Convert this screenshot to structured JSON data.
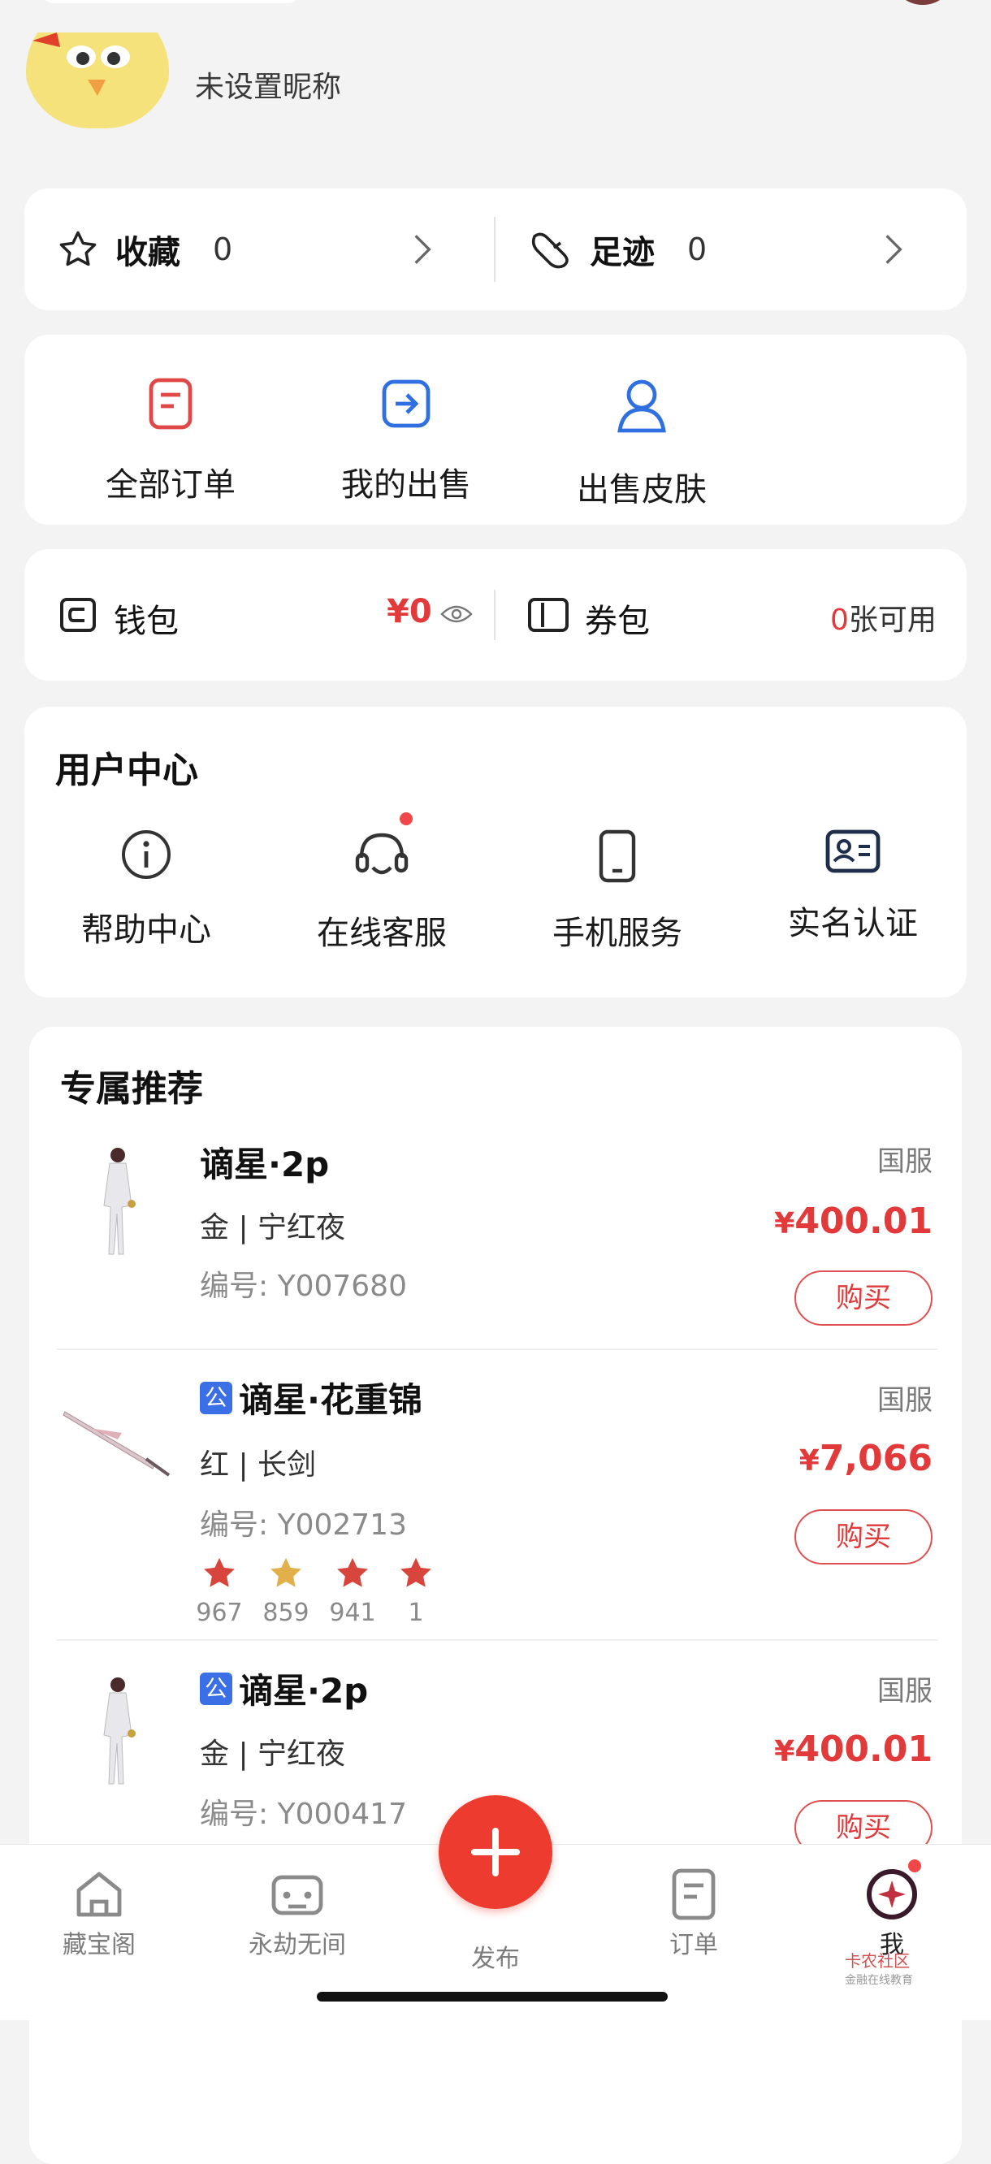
{
  "profile": {
    "nickname": "未设置昵称"
  },
  "favorites": {
    "collect": {
      "label": "收藏",
      "count": "0"
    },
    "footprint": {
      "label": "足迹",
      "count": "0"
    }
  },
  "orders": [
    {
      "label": "全部订单",
      "icon": "order-list-icon"
    },
    {
      "label": "我的出售",
      "icon": "sell-arrow-icon"
    },
    {
      "label": "出售皮肤",
      "icon": "user-skin-icon"
    }
  ],
  "wallet": {
    "wallet_label": "钱包",
    "amount": "¥0",
    "coupon_label": "券包",
    "coupon_count": "0",
    "coupon_suffix": "张可用"
  },
  "user_center": {
    "title": "用户中心",
    "items": [
      {
        "label": "帮助中心",
        "icon": "info-icon"
      },
      {
        "label": "在线客服",
        "icon": "headset-icon",
        "has_dot": true
      },
      {
        "label": "手机服务",
        "icon": "phone-icon"
      },
      {
        "label": "实名认证",
        "icon": "id-card-icon"
      }
    ]
  },
  "recommend": {
    "title": "专属推荐",
    "items": [
      {
        "official": false,
        "name": "谪星·2p",
        "sub": "金 | 宁红夜",
        "code": "编号: Y007680",
        "server": "国服",
        "price_yen": "¥",
        "price": "400.01",
        "buy": "购买"
      },
      {
        "official": true,
        "official_badge": "公",
        "name": "谪星·花重锦",
        "sub": "红 | 长剑",
        "code": "编号: Y002713",
        "server": "国服",
        "price_yen": "¥",
        "price": "7,066",
        "buy": "购买",
        "stars": [
          "967",
          "859",
          "941",
          "1"
        ]
      },
      {
        "official": true,
        "official_badge": "公",
        "name": "谪星·2p",
        "sub": "金 | 宁红夜",
        "code": "编号: Y000417",
        "server": "国服",
        "price_yen": "¥",
        "price": "400.01",
        "buy": "购买"
      }
    ]
  },
  "tabbar": {
    "tabs": [
      {
        "label": "藏宝阁",
        "icon": "home-icon"
      },
      {
        "label": "永劫无间",
        "icon": "gamepad-icon"
      },
      {
        "label": "发布",
        "icon": "plus-icon"
      },
      {
        "label": "订单",
        "icon": "order-doc-icon"
      },
      {
        "label": "我",
        "icon": "profile-star-icon"
      }
    ]
  },
  "watermark": {
    "text": "卡农社区",
    "sub": "金融在线教育"
  },
  "colors": {
    "accent_red": "#e23a3a",
    "blue_icon": "#2f6fe0",
    "publish_red": "#ee3b2f"
  }
}
